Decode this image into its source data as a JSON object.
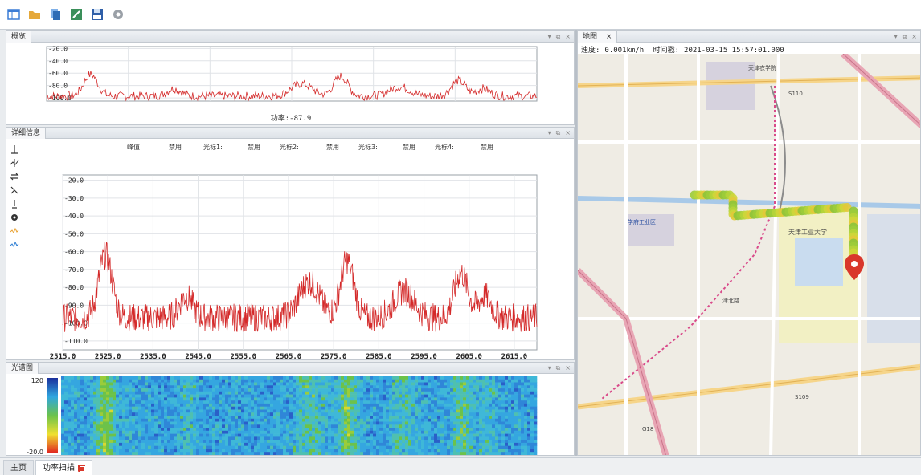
{
  "toolbar": {
    "buttons": [
      {
        "name": "layout-icon",
        "color": "#3c7dd6"
      },
      {
        "name": "folder-icon",
        "color": "#e5a83a"
      },
      {
        "name": "copy-icon",
        "color": "#2f6db5"
      },
      {
        "name": "export-icon",
        "color": "#3a8f5a"
      },
      {
        "name": "save-icon",
        "color": "#2f5fa8"
      },
      {
        "name": "settings-icon",
        "color": "#8a8f96"
      }
    ]
  },
  "overview": {
    "title": "概览",
    "power_label": "功率:-87.9",
    "chart_data": {
      "type": "line",
      "ylim": [
        -105,
        -17
      ],
      "yticks": [
        "-20.0",
        "-40.0",
        "-60.0",
        "-80.0",
        "-100.0"
      ],
      "series_color": "#d42a2a"
    }
  },
  "detail": {
    "title": "详细信息",
    "markers": [
      {
        "label": "峰值",
        "value": "禁用"
      },
      {
        "label": "光标1:",
        "value": "禁用"
      },
      {
        "label": "光标2:",
        "value": "禁用"
      },
      {
        "label": "光标3:",
        "value": "禁用"
      },
      {
        "label": "光标4:",
        "value": "禁用"
      }
    ],
    "chart_data": {
      "type": "line",
      "xlim": [
        2515,
        2620
      ],
      "ylim": [
        -115,
        -17
      ],
      "xticks": [
        "2515.0",
        "2525.0",
        "2535.0",
        "2545.0",
        "2555.0",
        "2565.0",
        "2575.0",
        "2585.0",
        "2595.0",
        "2605.0",
        "2615.0"
      ],
      "yticks": [
        "-20.0",
        "-30.0",
        "-40.0",
        "-50.0",
        "-60.0",
        "-70.0",
        "-80.0",
        "-90.0",
        "-100.0",
        "-110.0"
      ],
      "series_color": "#d42a2a",
      "grid": true
    }
  },
  "spectrogram": {
    "title": "光谱图",
    "scale_top": "120",
    "scale_bottom": "-20.0"
  },
  "map": {
    "tab_label": "地图",
    "tab_close": "×",
    "speed_label": "速度:",
    "speed_value": "0.001km/h",
    "time_label": "时间戳:",
    "time_value": "2021-03-15 15:57:01.000",
    "labels": [
      {
        "text": "天津农学院",
        "id": "l1"
      },
      {
        "text": "天津工业大学",
        "id": "l2"
      },
      {
        "text": "学府工业区",
        "id": "l3"
      },
      {
        "text": "津北路",
        "id": "l4"
      },
      {
        "text": "S110",
        "id": "l5"
      },
      {
        "text": "S109",
        "id": "l6"
      },
      {
        "text": "G18",
        "id": "l7"
      }
    ]
  },
  "status": {
    "tabs": [
      "主页",
      "功率扫描"
    ]
  }
}
